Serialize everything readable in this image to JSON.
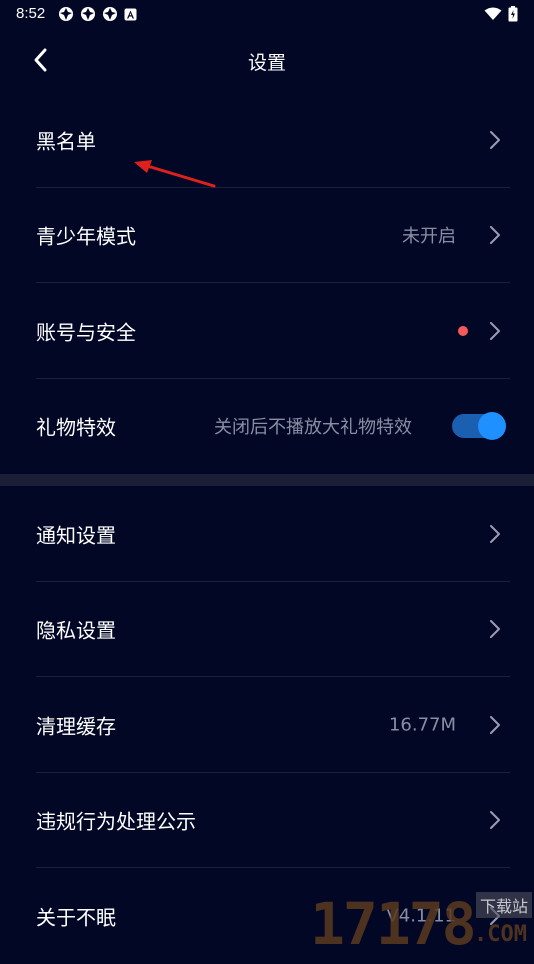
{
  "status_bar": {
    "time": "8:52"
  },
  "header": {
    "title": "设置"
  },
  "section1": [
    {
      "label": "黑名单",
      "value": "",
      "trailing": "chevron"
    },
    {
      "label": "青少年模式",
      "value": "未开启",
      "trailing": "chevron"
    },
    {
      "label": "账号与安全",
      "value": "",
      "trailing": "dot-chevron"
    },
    {
      "label": "礼物特效",
      "value": "关闭后不播放大礼物特效",
      "trailing": "toggle",
      "toggle_on": true
    }
  ],
  "section2": [
    {
      "label": "通知设置",
      "value": ""
    },
    {
      "label": "隐私设置",
      "value": ""
    },
    {
      "label": "清理缓存",
      "value": "16.77M"
    },
    {
      "label": "违规行为处理公示",
      "value": ""
    },
    {
      "label": "关于不眠",
      "value": "V4.1.11"
    }
  ],
  "watermark": {
    "number": "17178",
    "tag": "下载站",
    "com": ".COM"
  },
  "colors": {
    "background": "#020726",
    "divider": "#1a1f3a",
    "section_gap": "#1a1f36",
    "secondary_text": "#8a8ea3",
    "accent_blue": "#1e90ff",
    "red_dot": "#f45a5a",
    "annotation_arrow": "#e0201c"
  }
}
